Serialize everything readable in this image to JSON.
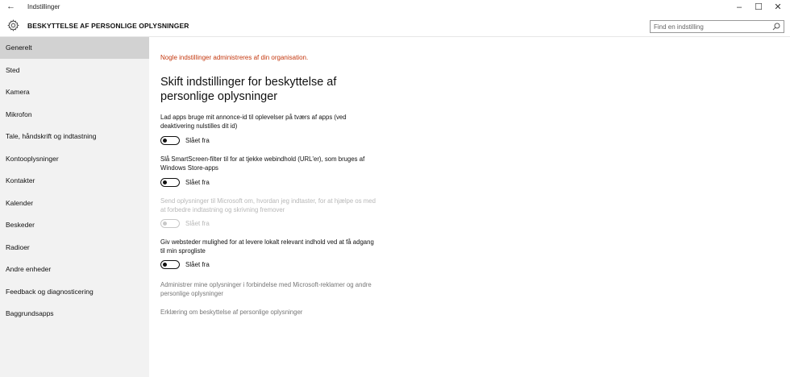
{
  "window": {
    "title": "Indstillinger",
    "back_glyph": "←",
    "minimize_glyph": "–",
    "maximize_glyph": "☐",
    "close_glyph": "✕"
  },
  "header": {
    "title": "BESKYTTELSE AF PERSONLIGE OPLYSNINGER",
    "search_placeholder": "Find en indstilling"
  },
  "sidebar": {
    "items": [
      {
        "label": "Generelt",
        "active": true
      },
      {
        "label": "Sted"
      },
      {
        "label": "Kamera"
      },
      {
        "label": "Mikrofon"
      },
      {
        "label": "Tale, håndskrift og indtastning"
      },
      {
        "label": "Kontooplysninger"
      },
      {
        "label": "Kontakter"
      },
      {
        "label": "Kalender"
      },
      {
        "label": "Beskeder"
      },
      {
        "label": "Radioer"
      },
      {
        "label": "Andre enheder"
      },
      {
        "label": "Feedback og diagnosticering"
      },
      {
        "label": "Baggrundsapps"
      }
    ]
  },
  "main": {
    "notice": "Nogle indstillinger administreres af din organisation.",
    "section_title": "Skift indstillinger for beskyttelse af personlige oplysninger",
    "settings": [
      {
        "description": "Lad apps bruge mit annonce-id til oplevelser på tværs af apps (ved deaktivering nulstilles dit id)",
        "state": "Slået fra",
        "enabled": true
      },
      {
        "description": "Slå SmartScreen-filter til for at tjekke webindhold (URL'er), som bruges af Windows Store-apps",
        "state": "Slået fra",
        "enabled": true
      },
      {
        "description": "Send oplysninger til Microsoft om, hvordan jeg indtaster, for at hjælpe os med at forbedre indtastning og skrivning fremover",
        "state": "Slået fra",
        "enabled": false
      },
      {
        "description": "Giv websteder mulighed for at levere lokalt relevant indhold ved at få adgang til min sprogliste",
        "state": "Slået fra",
        "enabled": true
      }
    ],
    "links": [
      "Administrer mine oplysninger i forbindelse med Microsoft-reklamer og andre personlige oplysninger",
      "Erklæring om beskyttelse af personlige oplysninger"
    ]
  },
  "colors": {
    "notice": "#c4380f",
    "sidebar_bg": "#f2f2f2",
    "sidebar_active": "#d2d2d2",
    "link": "#777777"
  }
}
